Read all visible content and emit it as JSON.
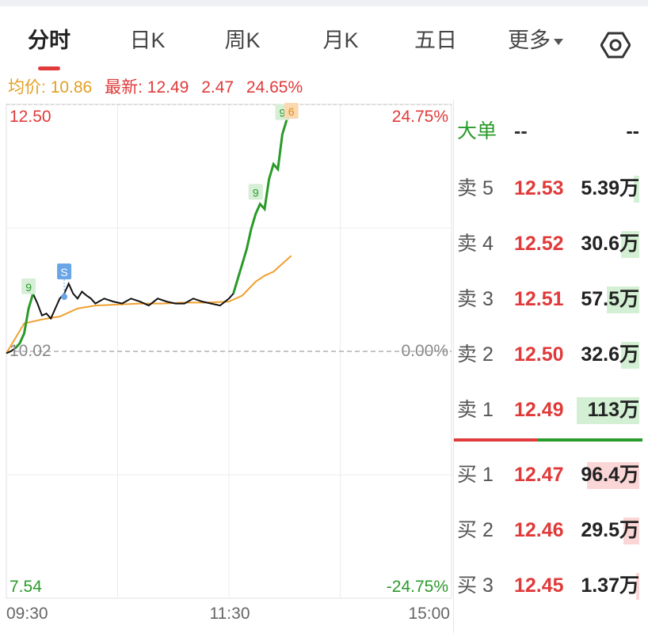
{
  "tabs": [
    {
      "label": "分时",
      "active": true
    },
    {
      "label": "日K",
      "active": false
    },
    {
      "label": "周K",
      "active": false
    },
    {
      "label": "月K",
      "active": false
    },
    {
      "label": "五日",
      "active": false
    },
    {
      "label": "更多",
      "active": false
    }
  ],
  "settings_icon": "hexagon-settings-icon",
  "info": {
    "avg_label": "均价:",
    "avg_value": "10.86",
    "latest_label": "最新:",
    "latest_value": "12.49",
    "change": "2.47",
    "change_pct": "24.65%"
  },
  "chart_data": {
    "type": "line",
    "x_ticks": [
      "09:30",
      "11:30",
      "15:00"
    ],
    "y_left_ticks": [
      "12.50",
      "10.02",
      "7.54"
    ],
    "y_right_ticks": [
      "24.75%",
      "0.00%",
      "-24.75%"
    ],
    "ylim": [
      7.54,
      12.5
    ],
    "prev_close": 10.02,
    "markers": [
      {
        "label": "9",
        "color": "green"
      },
      {
        "label": "S",
        "color": "blue"
      },
      {
        "label": "9",
        "color": "green"
      },
      {
        "label": "9",
        "color": "green"
      },
      {
        "label": "6",
        "color": "orange"
      }
    ],
    "series": [
      {
        "name": "price",
        "color": "#111111",
        "x": [
          0,
          0.01,
          0.02,
          0.03,
          0.04,
          0.05,
          0.06,
          0.07,
          0.08,
          0.09,
          0.1,
          0.11,
          0.12,
          0.13,
          0.14,
          0.15,
          0.16,
          0.17,
          0.18,
          0.19,
          0.2,
          0.22,
          0.24,
          0.26,
          0.28,
          0.3,
          0.32,
          0.34,
          0.36,
          0.38,
          0.4,
          0.42,
          0.44,
          0.46,
          0.48,
          0.5,
          0.51,
          0.52,
          0.53,
          0.54,
          0.55,
          0.56,
          0.57,
          0.58,
          0.59,
          0.6,
          0.61,
          0.62,
          0.63,
          0.64
        ],
        "y": [
          10.0,
          10.02,
          10.05,
          10.1,
          10.2,
          10.45,
          10.6,
          10.5,
          10.38,
          10.4,
          10.35,
          10.45,
          10.55,
          10.6,
          10.7,
          10.6,
          10.55,
          10.62,
          10.58,
          10.55,
          10.5,
          10.55,
          10.52,
          10.5,
          10.55,
          10.52,
          10.48,
          10.55,
          10.52,
          10.5,
          10.5,
          10.55,
          10.52,
          10.5,
          10.48,
          10.55,
          10.6,
          10.75,
          10.9,
          11.05,
          11.25,
          11.4,
          11.5,
          11.45,
          11.75,
          11.9,
          11.85,
          12.2,
          12.35,
          12.5
        ]
      },
      {
        "name": "avg",
        "color": "#f0a030",
        "x": [
          0,
          0.04,
          0.08,
          0.12,
          0.16,
          0.2,
          0.25,
          0.3,
          0.35,
          0.4,
          0.45,
          0.5,
          0.53,
          0.56,
          0.58,
          0.6,
          0.62,
          0.64
        ],
        "y": [
          10.0,
          10.3,
          10.34,
          10.37,
          10.45,
          10.48,
          10.49,
          10.5,
          10.5,
          10.51,
          10.51,
          10.52,
          10.58,
          10.72,
          10.78,
          10.82,
          10.9,
          10.98
        ]
      }
    ]
  },
  "depth": {
    "big_order_label": "大单",
    "big_order_price": "--",
    "big_order_vol": "--",
    "sells": [
      {
        "label": "卖 5",
        "price": "12.53",
        "vol": "5.39万",
        "bar": 0.08
      },
      {
        "label": "卖 4",
        "price": "12.52",
        "vol": "30.6万",
        "bar": 0.25
      },
      {
        "label": "卖 3",
        "price": "12.51",
        "vol": "57.5万",
        "bar": 0.45
      },
      {
        "label": "卖 2",
        "price": "12.50",
        "vol": "32.6万",
        "bar": 0.25
      },
      {
        "label": "卖 1",
        "price": "12.49",
        "vol": "113万",
        "bar": 0.86
      }
    ],
    "buys": [
      {
        "label": "买 1",
        "price": "12.47",
        "vol": "96.4万",
        "bar": 0.72
      },
      {
        "label": "买 2",
        "price": "12.46",
        "vol": "29.5万",
        "bar": 0.22
      },
      {
        "label": "买 3",
        "price": "12.45",
        "vol": "1.37万",
        "bar": 0.03
      }
    ],
    "colors": {
      "up": "#e03a3a",
      "down": "#2a9a2a",
      "sell_bar": "#d4f0d4",
      "buy_bar": "#fbd6d6"
    }
  }
}
